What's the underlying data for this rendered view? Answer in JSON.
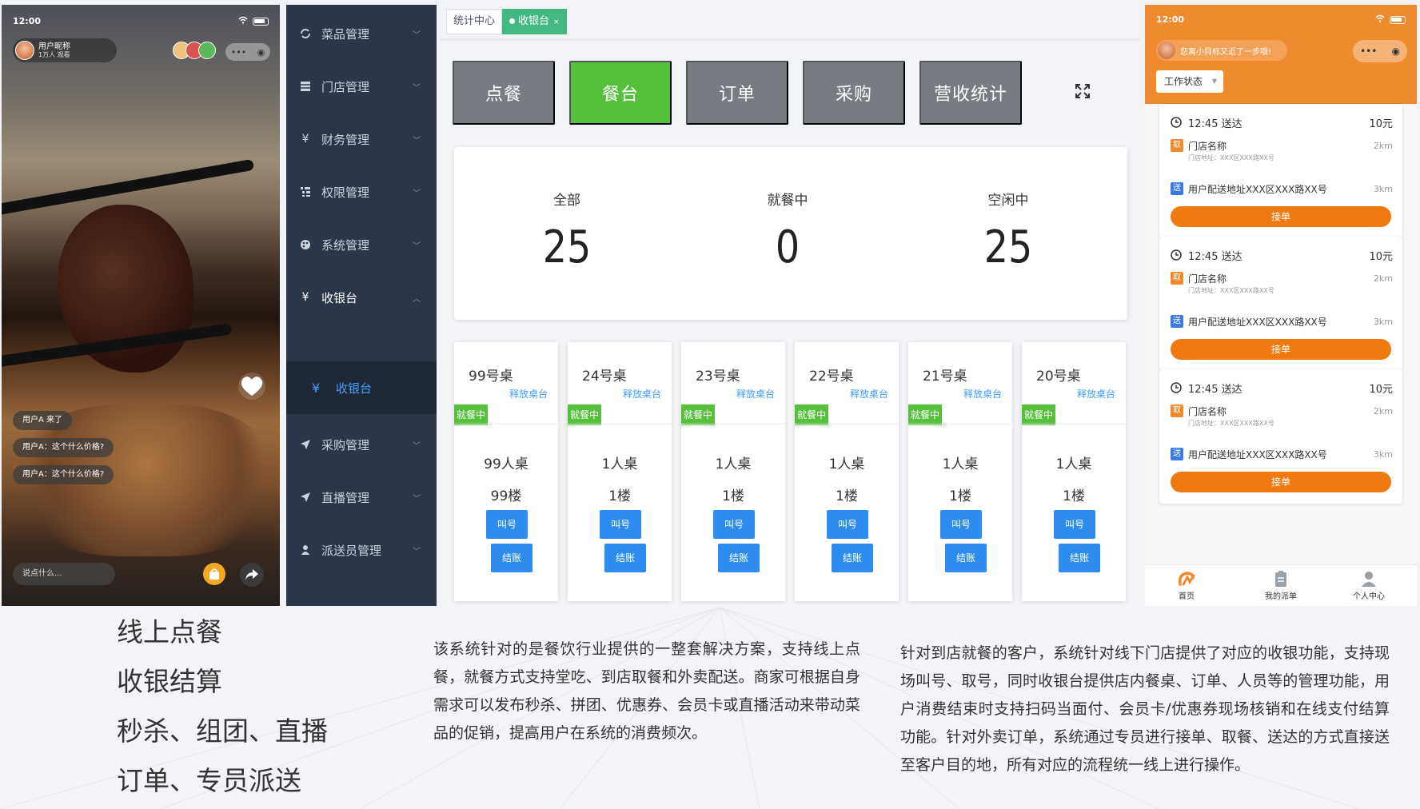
{
  "phone_left": {
    "status_time": "12:00",
    "host_name": "用户昵称",
    "host_viewers": "1万人 观看",
    "chat_messages": [
      "用户A  来了",
      "用户A：这个什么价格?",
      "用户A：这个什么价格?"
    ],
    "input_placeholder": "说点什么..."
  },
  "sidebar": {
    "items": [
      {
        "label": "菜品管理",
        "icon": "refresh-icon"
      },
      {
        "label": "门店管理",
        "icon": "grid-icon"
      },
      {
        "label": "财务管理",
        "icon": "yen-icon"
      },
      {
        "label": "权限管理",
        "icon": "list-icon"
      },
      {
        "label": "系统管理",
        "icon": "palette-icon"
      },
      {
        "label": "收银台",
        "icon": "yen-icon"
      },
      {
        "label": "采购管理",
        "icon": "send-icon"
      },
      {
        "label": "直播管理",
        "icon": "send-icon"
      },
      {
        "label": "派送员管理",
        "icon": "user-icon"
      }
    ],
    "active_submenu": "收银台"
  },
  "main": {
    "tabs": [
      {
        "label": "统计中心"
      },
      {
        "label": "收银台"
      }
    ],
    "tab_close": "×",
    "action_buttons": [
      "点餐",
      "餐台",
      "订单",
      "采购",
      "营收统计"
    ],
    "stats": [
      {
        "label": "全部",
        "value": "25"
      },
      {
        "label": "就餐中",
        "value": "0"
      },
      {
        "label": "空闲中",
        "value": "25"
      }
    ],
    "tables": [
      {
        "name": "99号桌",
        "release": "释放桌台",
        "status": "就餐中",
        "people": "99人桌",
        "floor": "99楼",
        "call": "叫号",
        "pay": "结账"
      },
      {
        "name": "24号桌",
        "release": "释放桌台",
        "status": "就餐中",
        "people": "1人桌",
        "floor": "1楼",
        "call": "叫号",
        "pay": "结账"
      },
      {
        "name": "23号桌",
        "release": "释放桌台",
        "status": "就餐中",
        "people": "1人桌",
        "floor": "1楼",
        "call": "叫号",
        "pay": "结账"
      },
      {
        "name": "22号桌",
        "release": "释放桌台",
        "status": "就餐中",
        "people": "1人桌",
        "floor": "1楼",
        "call": "叫号",
        "pay": "结账"
      },
      {
        "name": "21号桌",
        "release": "释放桌台",
        "status": "就餐中",
        "people": "1人桌",
        "floor": "1楼",
        "call": "叫号",
        "pay": "结账"
      },
      {
        "name": "20号桌",
        "release": "释放桌台",
        "status": "就餐中",
        "people": "1人桌",
        "floor": "1楼",
        "call": "叫号",
        "pay": "结账"
      }
    ]
  },
  "phone_right": {
    "status_time": "12:00",
    "slogan": "您离小目标又近了一步哦!",
    "work_status": "工作状态",
    "orders": [
      {
        "time": "12:45 送达",
        "price": "10元",
        "take_badge": "取",
        "store": "门店名称",
        "store_addr": "门店地址：XXX区XXX路XX号",
        "dist_store": "2km",
        "send_badge": "送",
        "user_addr": "用户配送地址XXX区XXX路XX号",
        "dist_user": "3km",
        "accept": "接单"
      },
      {
        "time": "12:45 送达",
        "price": "10元",
        "take_badge": "取",
        "store": "门店名称",
        "store_addr": "门店地址：XXX区XXX路XX号",
        "dist_store": "2km",
        "send_badge": "送",
        "user_addr": "用户配送地址XXX区XXX路XX号",
        "dist_user": "3km",
        "accept": "接单"
      },
      {
        "time": "12:45 送达",
        "price": "10元",
        "take_badge": "取",
        "store": "门店名称",
        "store_addr": "门店地址：XXX区XXX路XX号",
        "dist_store": "2km",
        "send_badge": "送",
        "user_addr": "用户配送地址XXX区XXX路XX号",
        "dist_user": "3km",
        "accept": "接单"
      }
    ],
    "tabbar": [
      "首页",
      "我的派单",
      "个人中心"
    ]
  },
  "features": [
    "线上点餐",
    "收银结算",
    "秒杀、组团、直播",
    "订单、专员派送"
  ],
  "paragraph_1": "该系统针对的是餐饮行业提供的一整套解决方案，支持线上点餐，就餐方式支持堂吃、到店取餐和外卖配送。商家可根据自身需求可以发布秒杀、拼团、优惠券、会员卡或直播活动来带动菜品的促销，提高用户在系统的消费频次。",
  "paragraph_2": "针对到店就餐的客户，系统针对线下门店提供了对应的收银功能，支持现场叫号、取号，同时收银台提供店内餐桌、订单、人员等的管理功能，用户消费结束时支持扫码当面付、会员卡/优惠券现场核销和在线支付结算功能。针对外卖订单，系统通过专员进行接单、取餐、送达的方式直接送至客户目的地，所有对应的流程统一线上进行操作。",
  "colors": {
    "sidebar_bg": "#2b3648",
    "accent_green": "#56c03c",
    "tab_green": "#42b983",
    "button_gray": "#777b82",
    "link_blue": "#409eff",
    "call_blue": "#2d8cf0",
    "delivery_orange": "#f08a2e"
  }
}
